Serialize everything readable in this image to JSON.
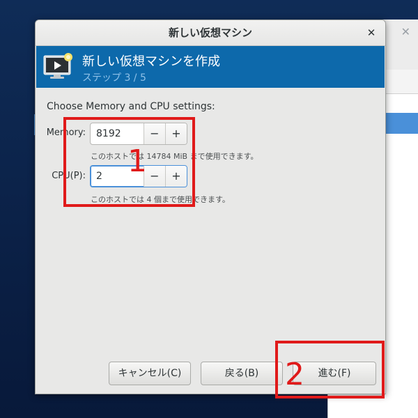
{
  "dialog": {
    "title": "新しい仮想マシン",
    "close_glyph": "✕"
  },
  "banner": {
    "title": "新しい仮想マシンを作成",
    "step": "ステップ 3 / 5"
  },
  "prompt": "Choose Memory and CPU settings:",
  "memory": {
    "label": "Memory:",
    "value": "8192",
    "minus": "−",
    "plus": "+",
    "hint": "このホストでは 14784 MiB まで使用できます。"
  },
  "cpu": {
    "label": "CPU(P):",
    "value": "2",
    "minus": "−",
    "plus": "+",
    "hint": "このホストでは 4 個まで使用できます。"
  },
  "buttons": {
    "cancel": "キャンセル(C)",
    "back": "戻る(B)",
    "forward": "進む(F)"
  },
  "annotations": {
    "one": "1",
    "two": "2"
  },
  "background_window": {
    "close_glyph": "✕"
  },
  "colors": {
    "banner": "#0d69ab",
    "annotation": "#e01a1a",
    "focus": "#4a90d9"
  }
}
